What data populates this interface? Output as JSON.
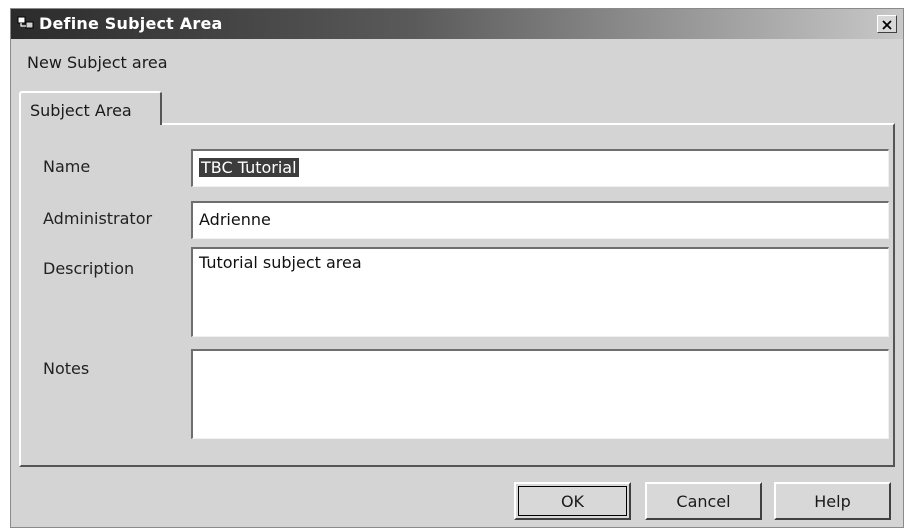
{
  "window": {
    "title": "Define Subject Area",
    "subtitle": "New Subject area"
  },
  "tabs": [
    {
      "label": "Subject Area",
      "selected": true
    }
  ],
  "form": {
    "name_label": "Name",
    "name_value": "TBC Tutorial",
    "administrator_label": "Administrator",
    "administrator_value": "Adrienne",
    "description_label": "Description",
    "description_value": "Tutorial subject area",
    "notes_label": "Notes",
    "notes_value": ""
  },
  "buttons": {
    "ok": "OK",
    "cancel": "Cancel",
    "help": "Help"
  },
  "icons": {
    "app": "app-window-icon",
    "close": "close-icon"
  }
}
